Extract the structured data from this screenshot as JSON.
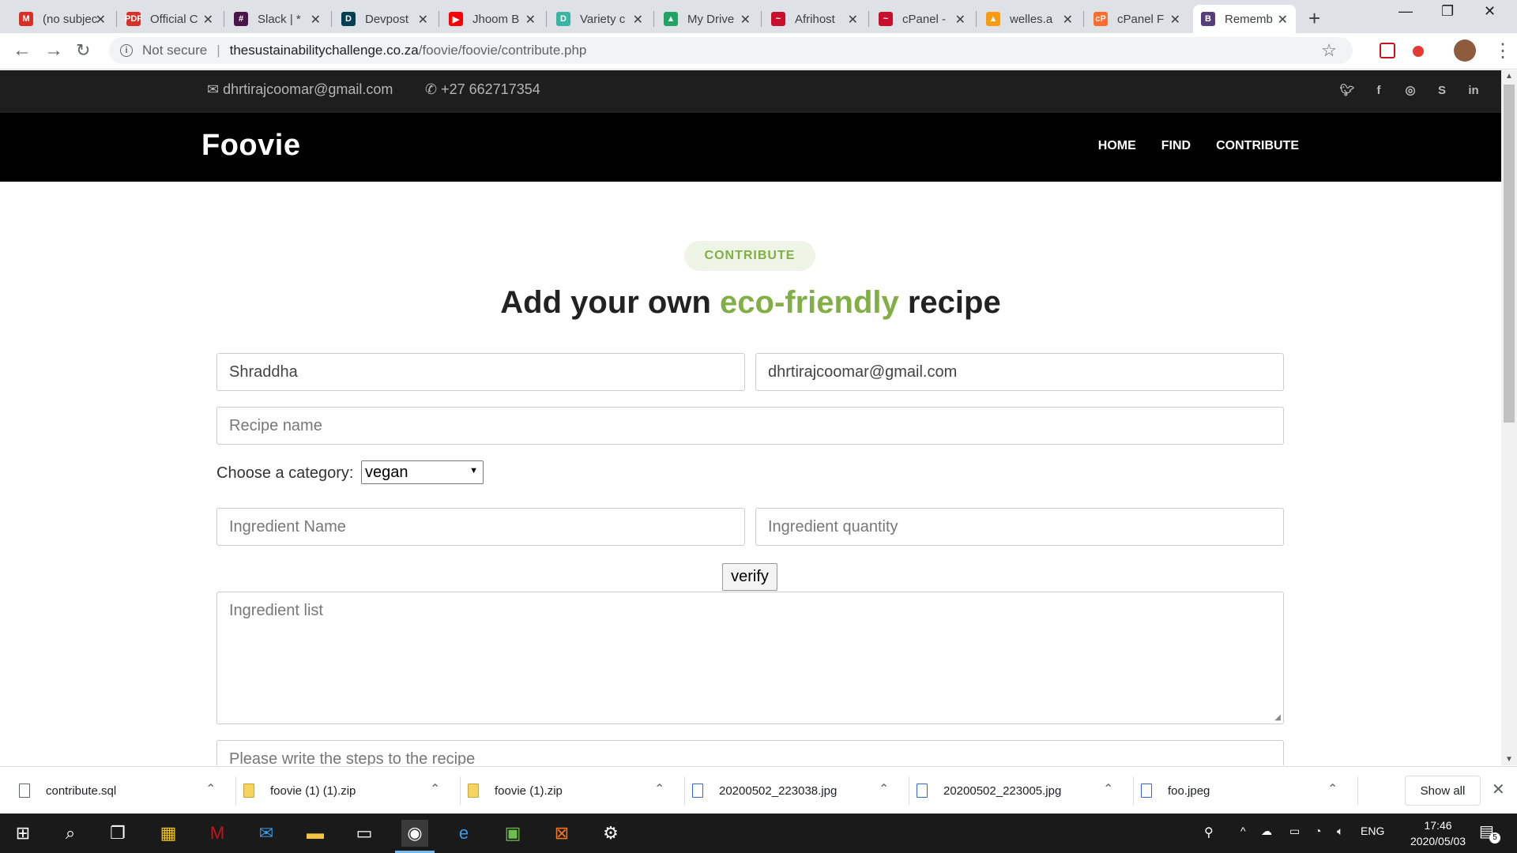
{
  "browser": {
    "tabs": [
      {
        "title": "(no subject)",
        "icon": "gmail-icon",
        "color": "#d93025",
        "glyph": "M"
      },
      {
        "title": "Official C",
        "icon": "pdf-icon",
        "color": "#d93025",
        "glyph": "PDF"
      },
      {
        "title": "Slack | *",
        "icon": "slack-icon",
        "color": "#4a154b",
        "glyph": "#"
      },
      {
        "title": "Devpost",
        "icon": "devpost-icon",
        "color": "#003e54",
        "glyph": "D"
      },
      {
        "title": "Jhoom B",
        "icon": "youtube-icon",
        "color": "#ff0000",
        "glyph": "▶"
      },
      {
        "title": "Variety c",
        "icon": "doc-icon",
        "color": "#3cb4a4",
        "glyph": "D"
      },
      {
        "title": "My Drive",
        "icon": "drive-icon",
        "color": "#1fa463",
        "glyph": "▲"
      },
      {
        "title": "Afrihost",
        "icon": "afrihost-icon",
        "color": "#c8102e",
        "glyph": "~"
      },
      {
        "title": "cPanel -",
        "icon": "afrihost-icon",
        "color": "#c8102e",
        "glyph": "~"
      },
      {
        "title": "welles.a",
        "icon": "pma-icon",
        "color": "#f89c0e",
        "glyph": "▲"
      },
      {
        "title": "cPanel F",
        "icon": "cpanel-icon",
        "color": "#ff6c2c",
        "glyph": "cP"
      },
      {
        "title": "Rememb",
        "icon": "bootstrap-icon",
        "color": "#563d7c",
        "glyph": "B"
      }
    ],
    "not_secure": "Not secure",
    "url_host": "thesustainabilitychallenge.co.za",
    "url_path": "/foovie/foovie/contribute.php"
  },
  "site": {
    "email": "dhrtirajcoomar@gmail.com",
    "phone": "+27 662717354",
    "logo": "Foovie",
    "nav": [
      "HOME",
      "FIND",
      "CONTRIBUTE"
    ],
    "badge": "CONTRIBUTE",
    "heading_a": "Add your own ",
    "heading_accent": "eco-friendly",
    "heading_b": " recipe",
    "accent_color": "#82ae46"
  },
  "form": {
    "name_value": "Shraddha",
    "email_value": "dhrtirajcoomar@gmail.com",
    "recipe_placeholder": "Recipe name",
    "category_label": "Choose a category:",
    "category_value": "vegan",
    "ingredient_name_placeholder": "Ingredient Name",
    "ingredient_qty_placeholder": "Ingredient quantity",
    "verify_label": "verify",
    "ingredient_list_placeholder": "Ingredient list",
    "steps_placeholder": "Please write the steps to the recipe"
  },
  "downloads": {
    "items": [
      {
        "name": "contribute.sql",
        "type": "sql"
      },
      {
        "name": "foovie (1) (1).zip",
        "type": "zip"
      },
      {
        "name": "foovie (1).zip",
        "type": "zip"
      },
      {
        "name": "20200502_223038.jpg",
        "type": "img"
      },
      {
        "name": "20200502_223005.jpg",
        "type": "img"
      },
      {
        "name": "foo.jpeg",
        "type": "img"
      }
    ],
    "show_all": "Show all"
  },
  "taskbar": {
    "lang": "ENG",
    "time": "17:46",
    "date": "2020/05/03",
    "notifications": "5"
  }
}
